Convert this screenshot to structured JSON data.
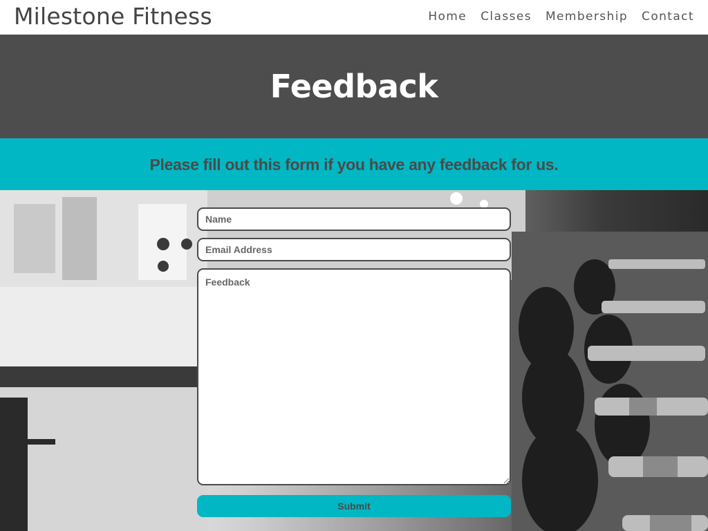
{
  "header": {
    "brand": "Milestone Fitness",
    "nav": [
      {
        "label": "Home"
      },
      {
        "label": "Classes"
      },
      {
        "label": "Membership"
      },
      {
        "label": "Contact"
      }
    ]
  },
  "hero": {
    "title": "Feedback"
  },
  "banner": {
    "text": "Please fill out this form if you have any feedback for us."
  },
  "form": {
    "name_placeholder": "Name",
    "name_value": "",
    "email_placeholder": "Email Address",
    "email_value": "",
    "feedback_placeholder": "Feedback",
    "feedback_value": "",
    "submit_label": "Submit"
  },
  "colors": {
    "accent": "#00b7c3",
    "hero_bg": "#4d4d4d",
    "text_dark": "#4a4a4a"
  },
  "background_image": {
    "subject": "gym dumbbell rack photo"
  }
}
